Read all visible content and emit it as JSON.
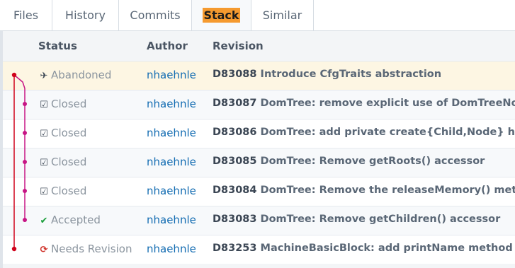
{
  "tabs": [
    {
      "label": "Files",
      "active": false
    },
    {
      "label": "History",
      "active": false
    },
    {
      "label": "Commits",
      "active": false
    },
    {
      "label": "Stack",
      "active": true
    },
    {
      "label": "Similar",
      "active": false
    }
  ],
  "columns": {
    "status": "Status",
    "author": "Author",
    "revision": "Revision"
  },
  "rows": [
    {
      "status": "Abandoned",
      "status_icon": "plane-icon",
      "author": "nhaehnle",
      "id": "D83088",
      "title": "Introduce CfgTraits abstraction",
      "current": true
    },
    {
      "status": "Closed",
      "status_icon": "check-square-icon",
      "author": "nhaehnle",
      "id": "D83087",
      "title": "DomTree: remove explicit use of DomTreeNodeBase::iterator"
    },
    {
      "status": "Closed",
      "status_icon": "check-square-icon",
      "author": "nhaehnle",
      "id": "D83086",
      "title": "DomTree: add private create{Child,Node} helpers"
    },
    {
      "status": "Closed",
      "status_icon": "check-square-icon",
      "author": "nhaehnle",
      "id": "D83085",
      "title": "DomTree: Remove getRoots() accessor"
    },
    {
      "status": "Closed",
      "status_icon": "check-square-icon",
      "author": "nhaehnle",
      "id": "D83084",
      "title": "DomTree: Remove the releaseMemory() method"
    },
    {
      "status": "Accepted",
      "status_icon": "check-icon",
      "author": "nhaehnle",
      "id": "D83083",
      "title": "DomTree: Remove getChildren() accessor"
    },
    {
      "status": "Needs Revision",
      "status_icon": "refresh-icon",
      "author": "nhaehnle",
      "id": "D83253",
      "title": "MachineBasicBlock: add printName method"
    }
  ],
  "colors": {
    "graph_red": "#d0021b",
    "graph_magenta": "#c71585",
    "accepted_green": "#1a9e3a",
    "revision_red": "#d0342c",
    "author_link": "#136cb2",
    "tab_highlight": "#f59a2f"
  }
}
